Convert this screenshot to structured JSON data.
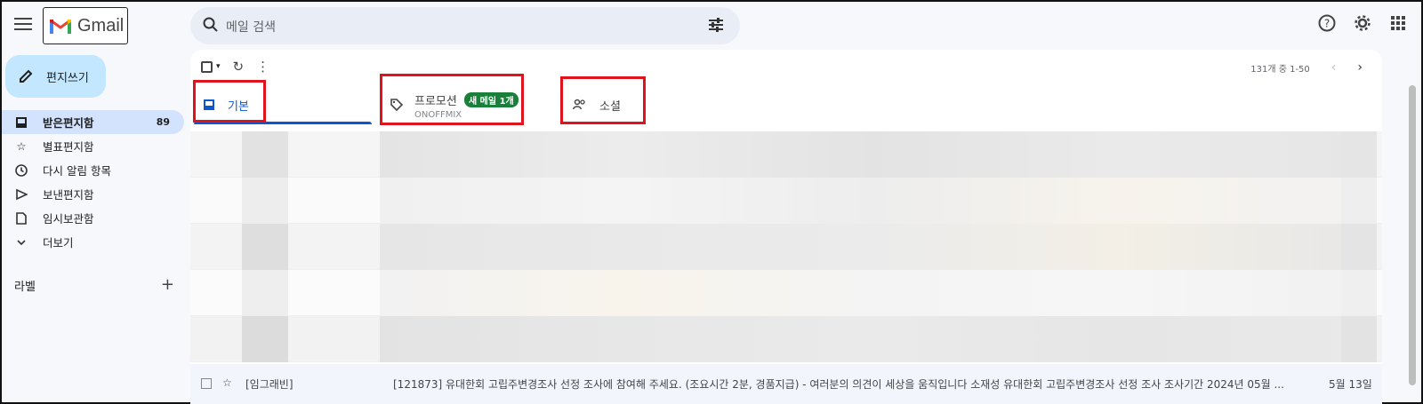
{
  "app": {
    "logo_text": "Gmail"
  },
  "search": {
    "placeholder": "메일 검색"
  },
  "compose": {
    "label": "편지쓰기"
  },
  "nav": [
    {
      "label": "받은편지함",
      "count": "89",
      "icon": "inbox-icon",
      "active": true
    },
    {
      "label": "별표편지함",
      "icon": "star-icon"
    },
    {
      "label": "다시 알림 항목",
      "icon": "clock-icon"
    },
    {
      "label": "보낸편지함",
      "icon": "send-icon"
    },
    {
      "label": "임시보관함",
      "icon": "draft-icon"
    },
    {
      "label": "더보기",
      "icon": "chevron-down-icon"
    }
  ],
  "labels": {
    "title": "라벨"
  },
  "toolbar": {
    "pager_text": "131개 중 1-50"
  },
  "tabs": {
    "primary": {
      "label": "기본"
    },
    "promotions": {
      "label": "프로모션",
      "badge": "새 메일 1개",
      "sender": "ONOFFMIX"
    },
    "social": {
      "label": "소셜"
    }
  },
  "last_row": {
    "sender": "[임그래빈]",
    "subject": "[121873] 유대한회 고립주변경조사 선정 조사에 참여해 주세요. (조요시간 2분, 경품지급) - 여러분의 의견이 세상을 움직입니다 소재성 유대한회 고립주변경조사 선정 조사 조사기간 2024년 05월 ...",
    "date": "5월 13일"
  },
  "colors": {
    "accent": "#0b57d0",
    "highlight_box": "#e0121c",
    "badge": "#188038",
    "compose_bg": "#c2e7ff"
  }
}
